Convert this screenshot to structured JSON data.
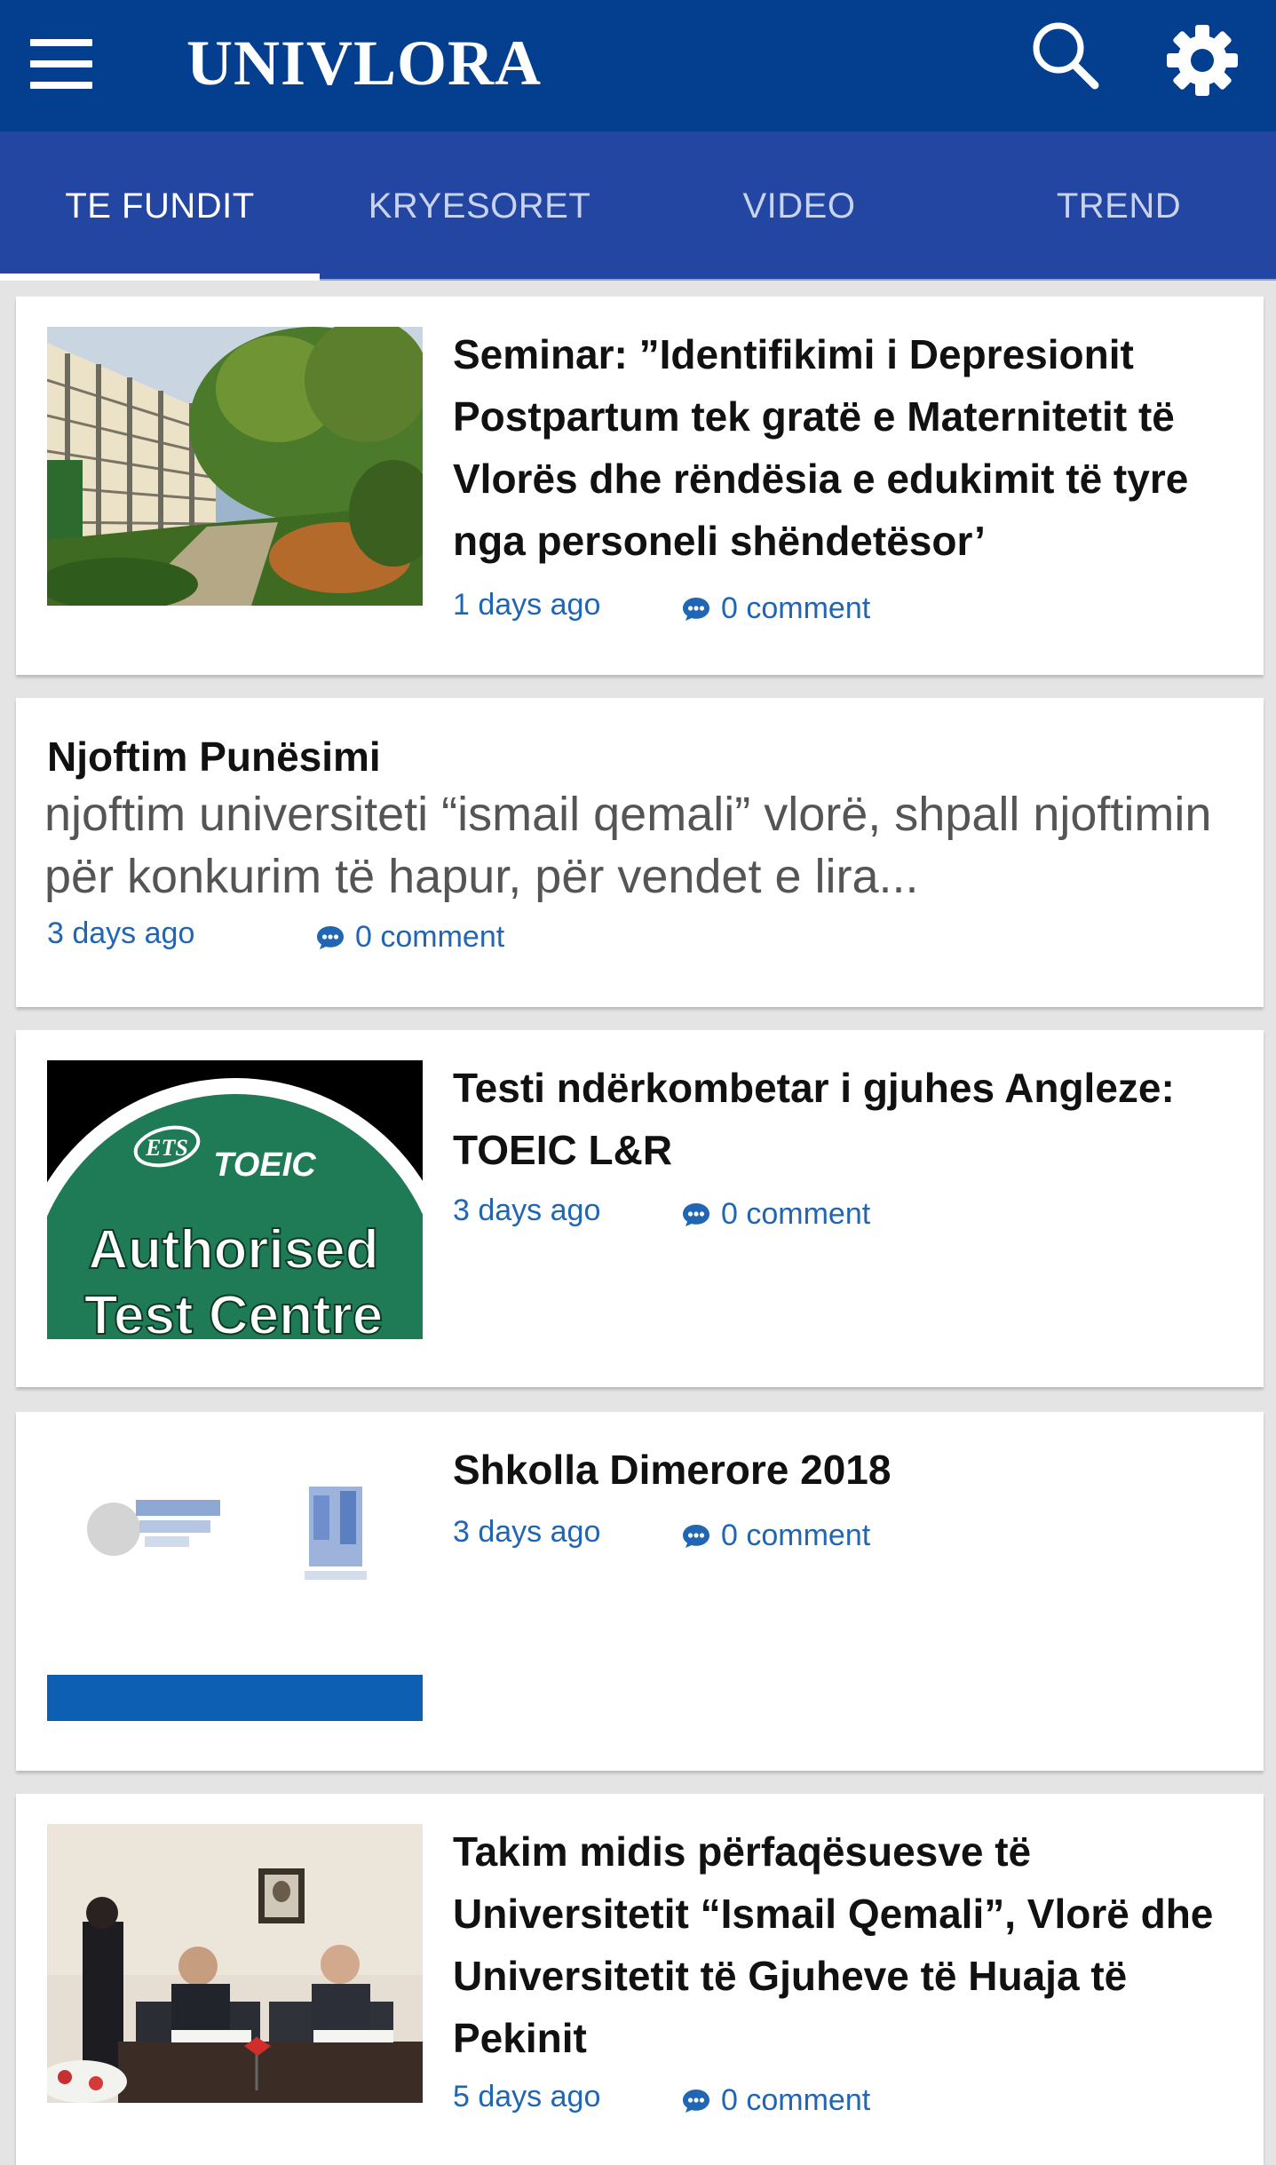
{
  "app": {
    "title": "UNIVLORA"
  },
  "icons": {
    "menu": "menu-icon",
    "search": "search-icon",
    "settings": "gear-icon",
    "comment": "chat-bubble-icon"
  },
  "colors": {
    "appbar": "#043f8f",
    "tabbar": "#2346a2",
    "link": "#2166b2",
    "background": "#e4e4e4"
  },
  "tabs": [
    {
      "label": "TE FUNDIT",
      "active": true
    },
    {
      "label": "KRYESORET",
      "active": false
    },
    {
      "label": "VIDEO",
      "active": false
    },
    {
      "label": "TREND",
      "active": false
    }
  ],
  "articles": [
    {
      "title": "Seminar: ”Identifikimi i Depresionit Postpartum tek gratë e Maternitetit të Vlorës dhe rëndësia e edukimit të tyre nga personeli shëndetësor’",
      "time": "1 days ago",
      "comments": "0 comment",
      "image": "university-building-photo"
    },
    {
      "title": "Njoftim Punësimi",
      "excerpt": "njoftim  universiteti “ismail qemali” vlorë, shpall njoftimin për konkurim të hapur, për vendet e lira...",
      "time": "3 days ago",
      "comments": "0 comment"
    },
    {
      "title": "Testi ndërkombetar i gjuhes Angleze: TOEIC L&R",
      "time": "3 days ago",
      "comments": "0 comment",
      "image": "toeic-authorised-test-centre-badge",
      "badge": {
        "ets": "ETS",
        "toeic": "TOEIC",
        "line1": "Authorised",
        "line2": "Test Centre"
      }
    },
    {
      "title": "Shkolla Dimerore 2018",
      "time": "3 days ago",
      "comments": "0 comment",
      "image": "blurred-logos-banner"
    },
    {
      "title": "Takim midis përfaqësuesve të Universitetit “Ismail Qemali”, Vlorë dhe Universitetit të Gjuheve të Huaja të Pekinit",
      "time": "5 days ago",
      "comments": "0 comment",
      "image": "signing-ceremony-photo"
    }
  ]
}
